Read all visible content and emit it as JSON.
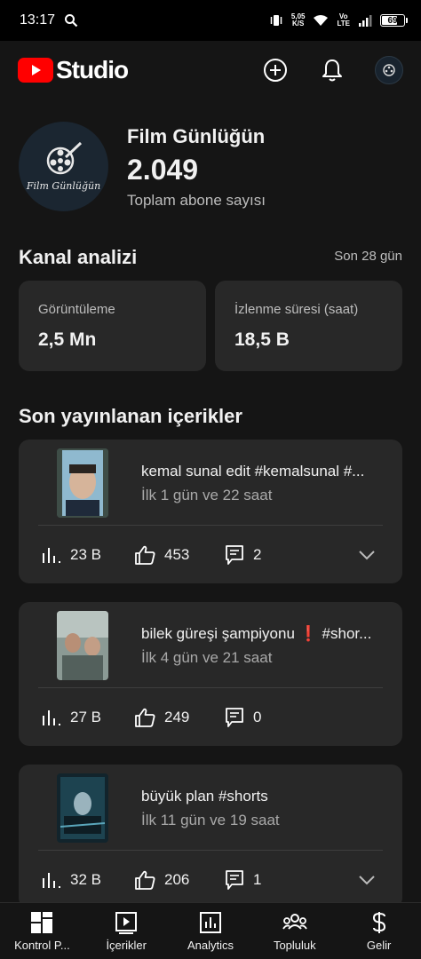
{
  "status_bar": {
    "time": "13:17",
    "speed_value": "5,05",
    "speed_unit": "K/S",
    "volte_top": "Vo",
    "volte_bottom": "LTE",
    "battery": "69"
  },
  "header": {
    "logo_text": "Studio",
    "icons": [
      "create-icon",
      "notifications-icon",
      "account-avatar"
    ]
  },
  "channel": {
    "avatar_text": "Film Günlüğün",
    "name": "Film Günlüğün",
    "subscriber_count": "2.049",
    "subscriber_label": "Toplam abone sayısı"
  },
  "analytics": {
    "title": "Kanal analizi",
    "period": "Son 28 gün",
    "metrics": [
      {
        "label": "Görüntüleme",
        "value": "2,5 Mn"
      },
      {
        "label": "İzlenme süresi (saat)",
        "value": "18,5 B"
      }
    ]
  },
  "recent": {
    "title": "Son yayınlanan içerikler",
    "items": [
      {
        "title": "kemal sunal edit #kemalsunal #...",
        "subtitle": "İlk 1 gün ve 22 saat",
        "views": "23 B",
        "likes": "453",
        "comments": "2"
      },
      {
        "title": "bilek güreşi şampiyonu ❗ #shor...",
        "subtitle": "İlk 4 gün ve 21 saat",
        "views": "27 B",
        "likes": "249",
        "comments": "0"
      },
      {
        "title": "büyük plan #shorts",
        "subtitle": "İlk 11 gün ve 19 saat",
        "views": "32 B",
        "likes": "206",
        "comments": "1"
      }
    ]
  },
  "bottom_nav": {
    "items": [
      {
        "label": "Kontrol P...",
        "icon": "dashboard-icon"
      },
      {
        "label": "İçerikler",
        "icon": "content-icon"
      },
      {
        "label": "Analytics",
        "icon": "analytics-icon"
      },
      {
        "label": "Topluluk",
        "icon": "community-icon"
      },
      {
        "label": "Gelir",
        "icon": "earn-icon"
      }
    ]
  },
  "colors": {
    "background": "#151515",
    "card": "#282828",
    "youtube_red": "#ff0000",
    "secondary_text": "#bdbdbd"
  }
}
